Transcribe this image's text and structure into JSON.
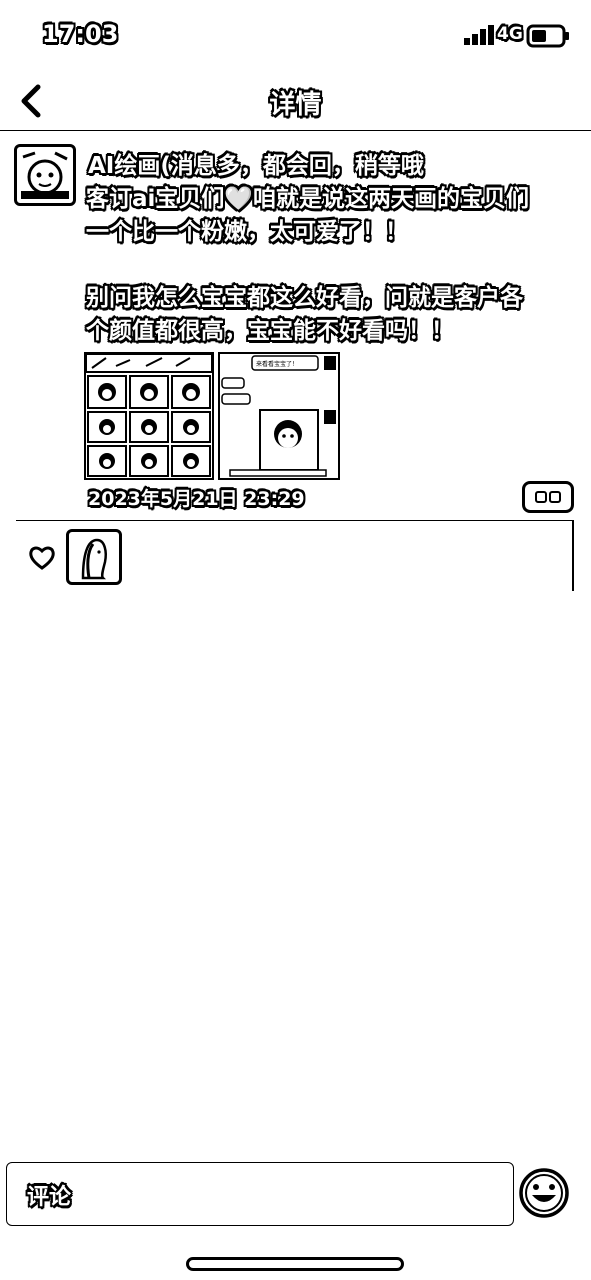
{
  "status_bar": {
    "time": "17:03",
    "network": "4G"
  },
  "nav": {
    "title": "详情"
  },
  "post": {
    "author": "AI绘画(消息多，都会回，稍等哦",
    "text_line1": "客订ai宝贝们🤍咱就是说这两天画的宝贝们",
    "text_line2": "一个比一个粉嫩，太可爱了！！",
    "text_line3": "别问我怎么宝宝都这么好看，问就是客户各",
    "text_line4": "个颜值都很高，宝宝能不好看吗！！",
    "image_right_caption": "来看看宝宝了！",
    "date": "2023年5月21日 23:29"
  },
  "comment_bar": {
    "placeholder": "评论"
  },
  "colors": {
    "background": "#ffffff",
    "ink": "#000000"
  },
  "icons": [
    "back-icon",
    "signal-icon",
    "battery-icon",
    "heart-icon",
    "more-dots-icon",
    "emoji-icon"
  ]
}
